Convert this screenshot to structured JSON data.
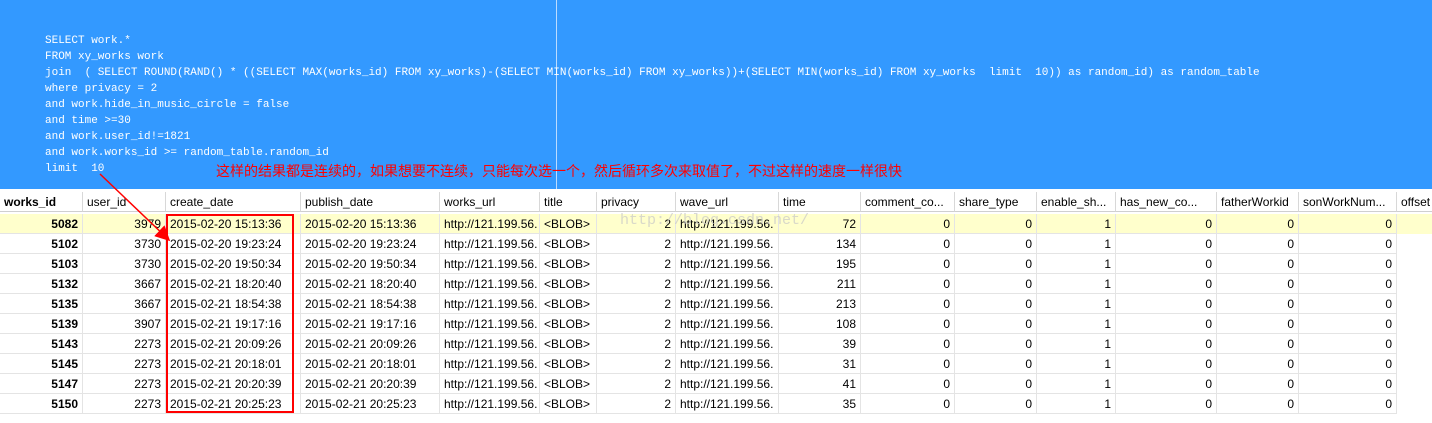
{
  "editor": {
    "sql_lines": [
      "SELECT work.*",
      "FROM xy_works work",
      "join  ( SELECT ROUND(RAND() * ((SELECT MAX(works_id) FROM xy_works)-(SELECT MIN(works_id) FROM xy_works))+(SELECT MIN(works_id) FROM xy_works  limit  10)) as random_id) as random_table",
      "where privacy = 2",
      "and work.hide_in_music_circle = false",
      "and time >=30",
      "and work.user_id!=1821",
      "and work.works_id >= random_table.random_id",
      "limit  10"
    ]
  },
  "annotation": {
    "text": "这样的结果都是连续的，如果想要不连续，只能每次选一个，然后循环多次来取值了，不过这样的速度一样很快",
    "color": "#ff0000"
  },
  "watermark": "http://blog.csdn.net/",
  "grid": {
    "columns": [
      "works_id",
      "user_id",
      "create_date",
      "publish_date",
      "works_url",
      "title",
      "privacy",
      "wave_url",
      "time",
      "comment_co...",
      "share_type",
      "enable_sh...",
      "has_new_co...",
      "fatherWorkid",
      "sonWorkNum...",
      "offset"
    ],
    "rows": [
      [
        "5082",
        "3979",
        "2015-02-20 15:13:36",
        "2015-02-20 15:13:36",
        "http://121.199.56.",
        "<BLOB>",
        "2",
        "http://121.199.56.",
        "72",
        "0",
        "0",
        "1",
        "0",
        "0",
        "0"
      ],
      [
        "5102",
        "3730",
        "2015-02-20 19:23:24",
        "2015-02-20 19:23:24",
        "http://121.199.56.",
        "<BLOB>",
        "2",
        "http://121.199.56.",
        "134",
        "0",
        "0",
        "1",
        "0",
        "0",
        "0"
      ],
      [
        "5103",
        "3730",
        "2015-02-20 19:50:34",
        "2015-02-20 19:50:34",
        "http://121.199.56.",
        "<BLOB>",
        "2",
        "http://121.199.56.",
        "195",
        "0",
        "0",
        "1",
        "0",
        "0",
        "0"
      ],
      [
        "5132",
        "3667",
        "2015-02-21 18:20:40",
        "2015-02-21 18:20:40",
        "http://121.199.56.",
        "<BLOB>",
        "2",
        "http://121.199.56.",
        "211",
        "0",
        "0",
        "1",
        "0",
        "0",
        "0"
      ],
      [
        "5135",
        "3667",
        "2015-02-21 18:54:38",
        "2015-02-21 18:54:38",
        "http://121.199.56.",
        "<BLOB>",
        "2",
        "http://121.199.56.",
        "213",
        "0",
        "0",
        "1",
        "0",
        "0",
        "0"
      ],
      [
        "5139",
        "3907",
        "2015-02-21 19:17:16",
        "2015-02-21 19:17:16",
        "http://121.199.56.",
        "<BLOB>",
        "2",
        "http://121.199.56.",
        "108",
        "0",
        "0",
        "1",
        "0",
        "0",
        "0"
      ],
      [
        "5143",
        "2273",
        "2015-02-21 20:09:26",
        "2015-02-21 20:09:26",
        "http://121.199.56.",
        "<BLOB>",
        "2",
        "http://121.199.56.",
        "39",
        "0",
        "0",
        "1",
        "0",
        "0",
        "0"
      ],
      [
        "5145",
        "2273",
        "2015-02-21 20:18:01",
        "2015-02-21 20:18:01",
        "http://121.199.56.",
        "<BLOB>",
        "2",
        "http://121.199.56.",
        "31",
        "0",
        "0",
        "1",
        "0",
        "0",
        "0"
      ],
      [
        "5147",
        "2273",
        "2015-02-21 20:20:39",
        "2015-02-21 20:20:39",
        "http://121.199.56.",
        "<BLOB>",
        "2",
        "http://121.199.56.",
        "41",
        "0",
        "0",
        "1",
        "0",
        "0",
        "0"
      ],
      [
        "5150",
        "2273",
        "2015-02-21 20:25:23",
        "2015-02-21 20:25:23",
        "http://121.199.56.",
        "<BLOB>",
        "2",
        "http://121.199.56.",
        "35",
        "0",
        "0",
        "1",
        "0",
        "0",
        "0"
      ]
    ],
    "selected_row": 0,
    "colors": {
      "selected_row": "#ffffcc",
      "editor_selection": "#3399ff",
      "highlight_box": "#ff0000"
    }
  }
}
